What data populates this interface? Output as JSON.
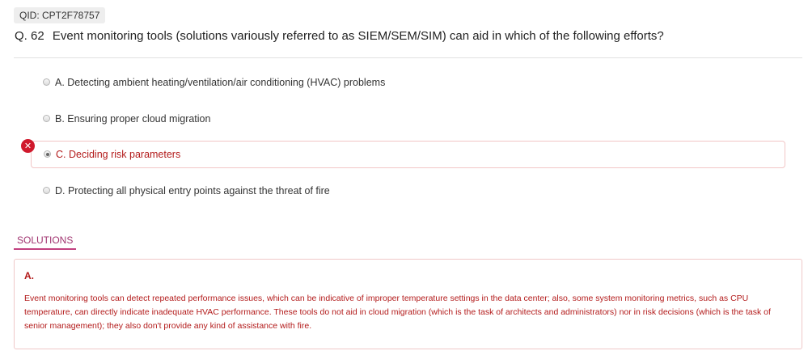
{
  "qid": "QID: CPT2F78757",
  "question": {
    "number": "Q. 62",
    "text": "Event monitoring tools (solutions variously referred to as SIEM/SEM/SIM) can aid in which of the following efforts?"
  },
  "options": [
    {
      "label": "A. Detecting ambient heating/ventilation/air conditioning (HVAC) problems",
      "selected": false
    },
    {
      "label": "B. Ensuring proper cloud migration",
      "selected": false
    },
    {
      "label": "C. Deciding risk parameters",
      "selected": true,
      "status": "wrong"
    },
    {
      "label": "D. Protecting all physical entry points against the threat of fire",
      "selected": false
    }
  ],
  "wrong_icon": "close-icon",
  "solutions": {
    "tab_label": "SOLUTIONS",
    "answer": "A.",
    "explanation": "Event monitoring tools can detect repeated performance issues, which can be indicative of improper temperature settings in the data center; also, some system monitoring metrics, such as CPU temperature, can directly indicate inadequate HVAC performance. These tools do not aid in cloud migration (which is the task of architects and administrators) nor in risk decisions (which is the task of senior management); they also don't provide any kind of assistance with fire."
  },
  "colors": {
    "wrong": "#d0192c",
    "solution_text": "#b31b1b",
    "tab_accent": "#c2407f"
  }
}
